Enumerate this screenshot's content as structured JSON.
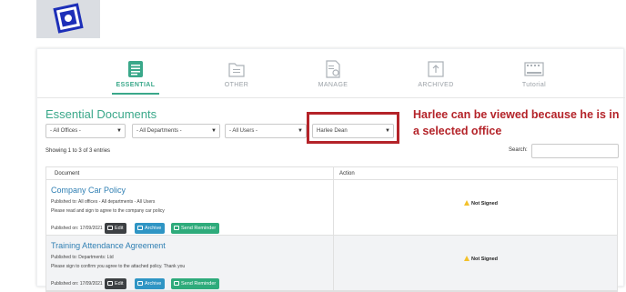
{
  "tabs": [
    {
      "label": "ESSENTIAL",
      "icon": "document-list-icon",
      "active": true
    },
    {
      "label": "OTHER",
      "icon": "folder-icon",
      "active": false
    },
    {
      "label": "MANAGE",
      "icon": "document-gear-icon",
      "active": false
    },
    {
      "label": "ARCHIVED",
      "icon": "archive-upload-icon",
      "active": false
    },
    {
      "label": "Tutorial",
      "icon": "video-player-icon",
      "active": false
    }
  ],
  "section_title": "Essential Documents",
  "filters": {
    "offices": "- All Offices -",
    "departments": "- All Departments -",
    "users": "- All Users -",
    "person": "Harlee Dean"
  },
  "annotation": "Harlee can be viewed because he is in a selected office",
  "table_info": "Showing 1 to 3 of 3 entries",
  "search_label": "Search:",
  "columns": {
    "document": "Document",
    "action": "Action"
  },
  "rows": [
    {
      "title": "Company Car Policy",
      "published_to": "Published to: All offices - All departments - All Users",
      "description": "Please read and sign to agree to the company car policy",
      "published_on": "Published on: 17/09/2021",
      "status": "Not Signed"
    },
    {
      "title": "Training Attendance Agreement",
      "published_to": "Published to: Departments: Ltd",
      "description": "Please sign to confirm you agree to the attached policy. Thank you",
      "published_on": "Published on: 17/09/2021",
      "status": "Not Signed"
    }
  ],
  "buttons": {
    "edit": "Edit",
    "archive": "Archive",
    "remind": "Send Reminder"
  },
  "colors": {
    "accent": "#3aa88a",
    "annotation": "#b42329",
    "link": "#2f7fb3",
    "archive": "#2f95c4",
    "remind": "#2eab7b"
  }
}
